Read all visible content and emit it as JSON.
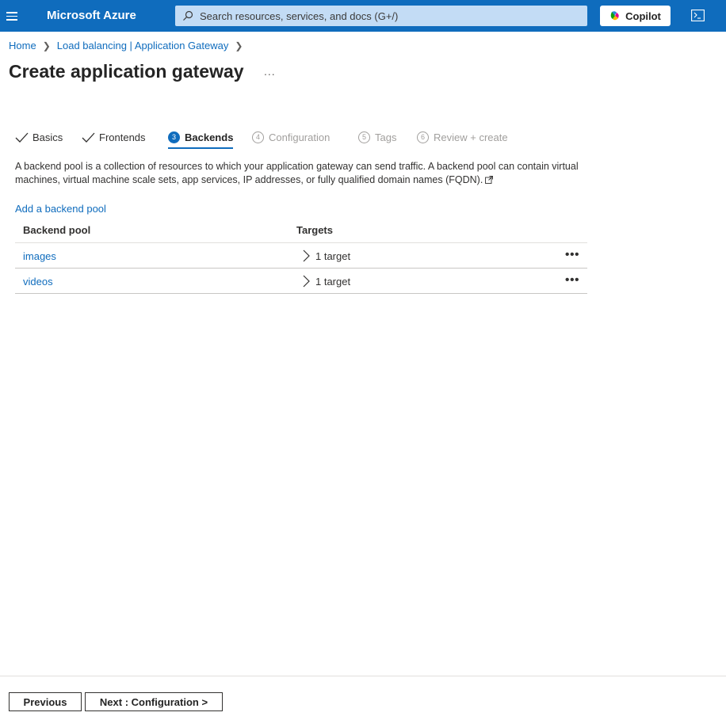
{
  "topbar": {
    "brand": "Microsoft Azure",
    "search_placeholder": "Search resources, services, and docs (G+/)",
    "copilot_label": "Copilot",
    "bar_color": "#0f6cbd"
  },
  "breadcrumb": {
    "items": [
      "Home",
      "Load balancing | Application Gateway"
    ]
  },
  "page": {
    "title": "Create application gateway",
    "more_label": "..."
  },
  "tabs": [
    {
      "label": "Basics",
      "state": "done"
    },
    {
      "label": "Frontends",
      "state": "done"
    },
    {
      "number": "3",
      "label": "Backends",
      "state": "active"
    },
    {
      "number": "4",
      "label": "Configuration",
      "state": "disabled"
    },
    {
      "number": "5",
      "label": "Tags",
      "state": "disabled"
    },
    {
      "number": "6",
      "label": "Review + create",
      "state": "disabled"
    }
  ],
  "description": "A backend pool is a collection of resources to which your application gateway can send traffic. A backend pool can contain virtual machines, virtual machine scale sets, app services, IP addresses, or fully qualified domain names (FQDN).",
  "add_pool_label": "Add a backend pool",
  "table": {
    "headers": [
      "Backend pool",
      "Targets"
    ],
    "rows": [
      {
        "name": "images",
        "targets": "1 target"
      },
      {
        "name": "videos",
        "targets": "1 target"
      }
    ]
  },
  "footer": {
    "previous_label": "Previous",
    "next_label": "Next : Configuration >"
  }
}
